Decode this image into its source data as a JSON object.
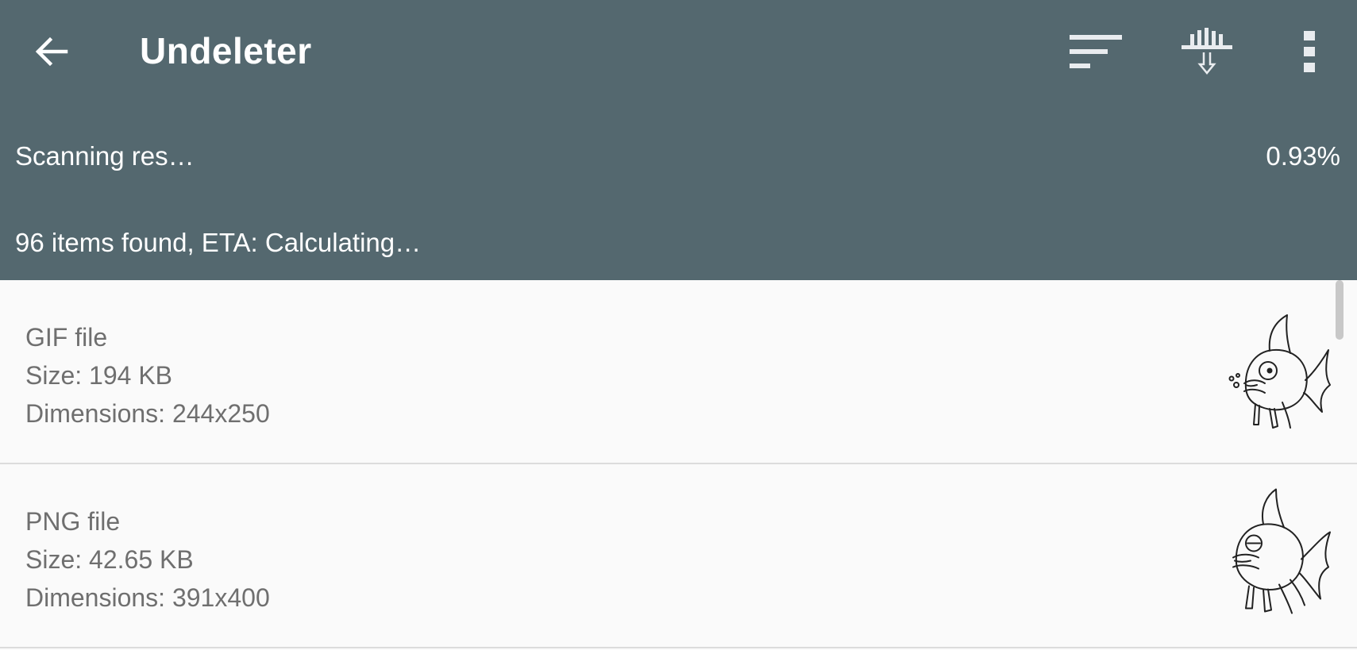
{
  "header": {
    "title": "Undeleter",
    "actions": {
      "back_icon": "arrow-left-icon",
      "sort_icon": "sort-icon",
      "filter_icon": "filter-download-icon",
      "more_icon": "more-vertical-icon"
    },
    "background_color": "#54686f"
  },
  "scan": {
    "label": "Scanning res…",
    "percent": "0.93%",
    "status": "96 items found, ETA: Calculating…"
  },
  "files": [
    {
      "type": "GIF file",
      "size": "Size: 194 KB",
      "dimensions": "Dimensions: 244x250",
      "thumbnail_icon": "fish-sketch-icon"
    },
    {
      "type": "PNG file",
      "size": "Size: 42.65 KB",
      "dimensions": "Dimensions: 391x400",
      "thumbnail_icon": "fish-sketch-icon"
    }
  ]
}
